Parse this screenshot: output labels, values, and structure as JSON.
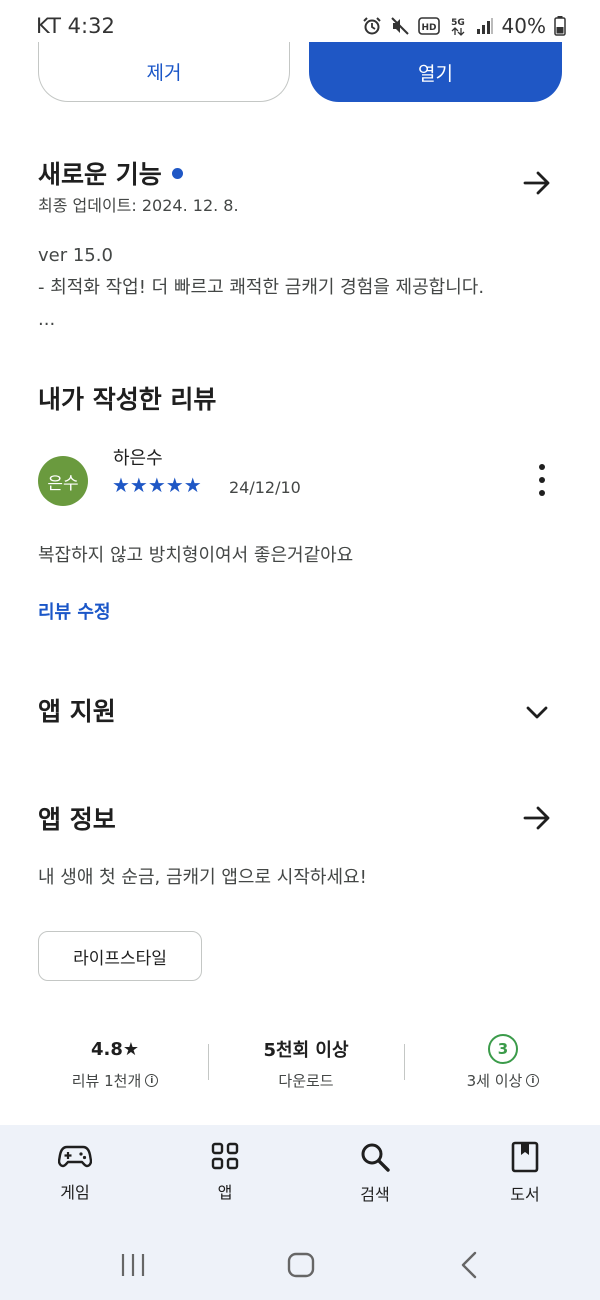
{
  "status_bar": {
    "carrier_time": "KT 4:32",
    "battery": "40%"
  },
  "actions": {
    "remove_label": "제거",
    "open_label": "열기"
  },
  "whats_new": {
    "title": "새로운 기능",
    "last_updated": "최종 업데이트: 2024. 12. 8.",
    "version": "ver 15.0",
    "line1": "- 최적화 작업! 더 빠르고 쾌적한 금캐기 경험을 제공합니다.",
    "ellipsis": "..."
  },
  "my_review": {
    "title": "내가 작성한 리뷰",
    "avatar_text": "은수",
    "reviewer_name": "하은수",
    "rating": 5,
    "stars": "★★★★★",
    "date": "24/12/10",
    "text": "복잡하지 않고 방치형이여서 좋은거같아요",
    "edit_label": "리뷰 수정"
  },
  "app_support": {
    "title": "앱 지원"
  },
  "app_info": {
    "title": "앱 정보",
    "description": "내 생애 첫 순금, 금캐기 앱으로 시작하세요!",
    "category_chip": "라이프스타일"
  },
  "stats": {
    "rating_value": "4.8★",
    "rating_label": "리뷰 1천개",
    "downloads_value": "5천회 이상",
    "downloads_label": "다운로드",
    "age_badge": "3",
    "age_label": "3세 이상"
  },
  "bottom_nav": {
    "items": [
      {
        "label": "게임",
        "icon": "gamepad-icon"
      },
      {
        "label": "앱",
        "icon": "apps-grid-icon"
      },
      {
        "label": "검색",
        "icon": "search-icon"
      },
      {
        "label": "도서",
        "icon": "book-icon"
      }
    ]
  },
  "colors": {
    "accent": "#1f57c5",
    "avatar_bg": "#6a9a3e",
    "age_badge": "#3b9b4a",
    "nav_bg": "#eef2f9"
  }
}
